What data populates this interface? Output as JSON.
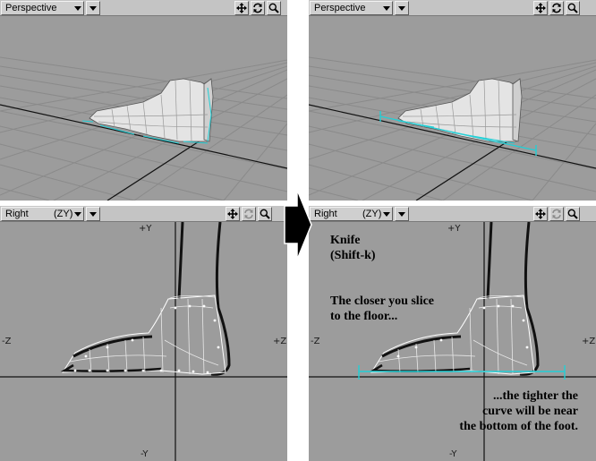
{
  "viewports": {
    "top_left": {
      "mode": "Perspective"
    },
    "top_right": {
      "mode": "Perspective"
    },
    "bottom_left": {
      "mode": "Right",
      "axes": "(ZY)"
    },
    "bottom_right": {
      "mode": "Right",
      "axes": "(ZY)"
    }
  },
  "axis_labels": {
    "plus_y": "+Y",
    "minus_y": "-Y",
    "minus_z": "-Z",
    "plus_z": "+Z"
  },
  "annotations": {
    "tool_name": "Knife",
    "shortcut": "(Shift-k)",
    "line1a": "The closer you slice",
    "line1b": "to the floor...",
    "line2a": "...the tighter the",
    "line2b": "curve will be near",
    "line2c": "the bottom of the foot."
  },
  "colors": {
    "viewport_bg": "#9c9c9c",
    "slice_line": "#22cfd6",
    "header_bg": "#c4c4c4"
  },
  "icons": [
    "move-view-icon",
    "rotate-view-icon",
    "zoom-view-icon",
    "arrow-right-icon"
  ]
}
